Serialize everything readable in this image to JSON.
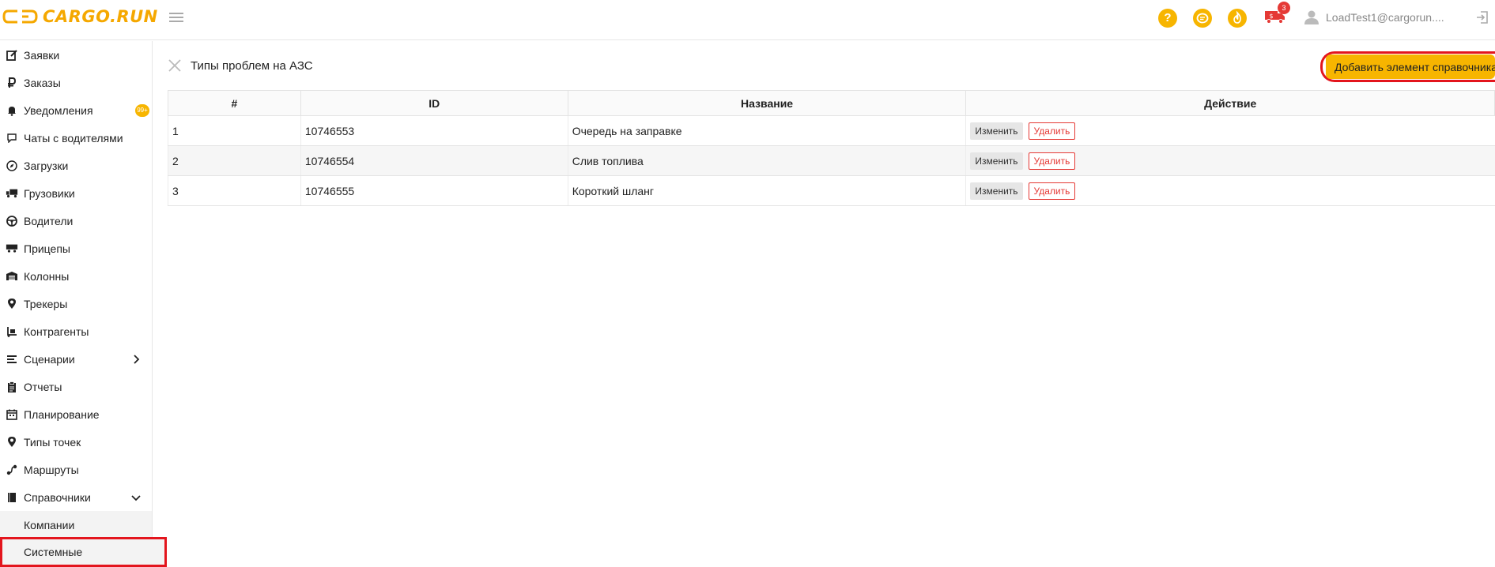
{
  "header": {
    "logo_text": "CARGO.RUN",
    "help_glyph": "?",
    "chat_glyph": "…",
    "fire_glyph": "△",
    "truck_badge": "3",
    "user": "LoadTest1@cargorun....",
    "accent_color": "#f7b500",
    "badge_color": "#e53935"
  },
  "sidebar": {
    "items": [
      {
        "label": "Заявки",
        "icon": "edit-icon"
      },
      {
        "label": "Заказы",
        "icon": "ruble-icon"
      },
      {
        "label": "Уведомления",
        "icon": "bell-icon",
        "badge": "99+"
      },
      {
        "label": "Чаты с водителями",
        "icon": "chat-bubble-icon"
      },
      {
        "label": "Загрузки",
        "icon": "compass-icon"
      },
      {
        "label": "Грузовики",
        "icon": "truck-icon"
      },
      {
        "label": "Водители",
        "icon": "steering-wheel-icon"
      },
      {
        "label": "Прицепы",
        "icon": "trailer-icon"
      },
      {
        "label": "Колонны",
        "icon": "warehouse-icon"
      },
      {
        "label": "Трекеры",
        "icon": "map-pin-icon"
      },
      {
        "label": "Контрагенты",
        "icon": "dolly-icon"
      },
      {
        "label": "Сценарии",
        "icon": "list-icon"
      },
      {
        "label": "Отчеты",
        "icon": "clipboard-icon"
      },
      {
        "label": "Планирование",
        "icon": "calendar-icon"
      },
      {
        "label": "Типы точек",
        "icon": "map-pin-icon"
      },
      {
        "label": "Маршруты",
        "icon": "route-icon"
      },
      {
        "label": "Справочники",
        "icon": "book-icon"
      }
    ],
    "subitems": [
      {
        "label": "Компании"
      },
      {
        "label": "Системные"
      }
    ]
  },
  "main": {
    "title": "Типы проблем на АЗС",
    "add_button": "Добавить элемент справочника",
    "columns": [
      "#",
      "ID",
      "Название",
      "Действие"
    ],
    "rows": [
      {
        "num": "1",
        "id": "10746553",
        "name": "Очередь на заправке"
      },
      {
        "num": "2",
        "id": "10746554",
        "name": "Слив топлива"
      },
      {
        "num": "3",
        "id": "10746555",
        "name": "Короткий шланг"
      }
    ],
    "edit_label": "Изменить",
    "delete_label": "Удалить"
  }
}
